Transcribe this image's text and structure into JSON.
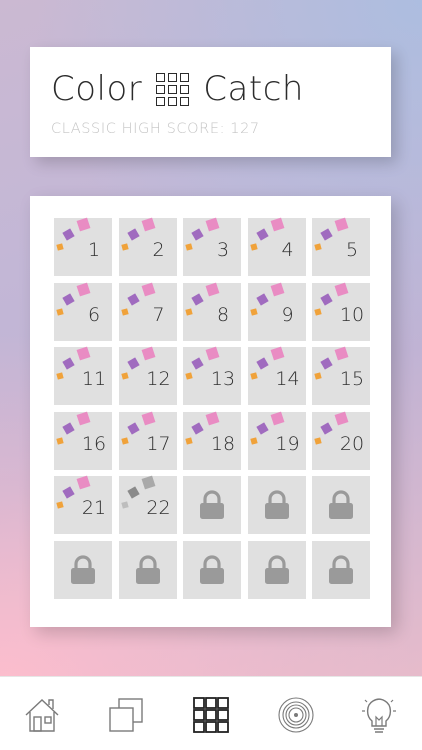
{
  "header": {
    "title_left": "Color",
    "title_right": "Catch",
    "high_score": "CLASSIC HIGH SCORE: 127"
  },
  "levels": [
    {
      "label": "1",
      "state": "unlocked"
    },
    {
      "label": "2",
      "state": "unlocked"
    },
    {
      "label": "3",
      "state": "unlocked"
    },
    {
      "label": "4",
      "state": "unlocked"
    },
    {
      "label": "5",
      "state": "unlocked"
    },
    {
      "label": "6",
      "state": "unlocked"
    },
    {
      "label": "7",
      "state": "unlocked"
    },
    {
      "label": "8",
      "state": "unlocked"
    },
    {
      "label": "9",
      "state": "unlocked"
    },
    {
      "label": "10",
      "state": "unlocked"
    },
    {
      "label": "11",
      "state": "unlocked"
    },
    {
      "label": "12",
      "state": "unlocked"
    },
    {
      "label": "13",
      "state": "unlocked"
    },
    {
      "label": "14",
      "state": "unlocked"
    },
    {
      "label": "15",
      "state": "unlocked"
    },
    {
      "label": "16",
      "state": "unlocked"
    },
    {
      "label": "17",
      "state": "unlocked"
    },
    {
      "label": "18",
      "state": "unlocked"
    },
    {
      "label": "19",
      "state": "unlocked"
    },
    {
      "label": "20",
      "state": "unlocked"
    },
    {
      "label": "21",
      "state": "unlocked"
    },
    {
      "label": "22",
      "state": "current"
    },
    {
      "label": "",
      "state": "locked"
    },
    {
      "label": "",
      "state": "locked"
    },
    {
      "label": "",
      "state": "locked"
    },
    {
      "label": "",
      "state": "locked"
    },
    {
      "label": "",
      "state": "locked"
    },
    {
      "label": "",
      "state": "locked"
    },
    {
      "label": "",
      "state": "locked"
    },
    {
      "label": "",
      "state": "locked"
    }
  ],
  "tabs": [
    {
      "icon": "home-icon",
      "active": false
    },
    {
      "icon": "layers-icon",
      "active": false
    },
    {
      "icon": "levels-grid-icon",
      "active": true
    },
    {
      "icon": "vinyl-record-icon",
      "active": false
    },
    {
      "icon": "lightbulb-icon",
      "active": false
    }
  ],
  "colors": {
    "pink": "#e98cc3",
    "purple": "#a06bbf",
    "orange": "#f0a23a",
    "tile": "#e0e0e0",
    "lock": "#9a9a9a"
  }
}
